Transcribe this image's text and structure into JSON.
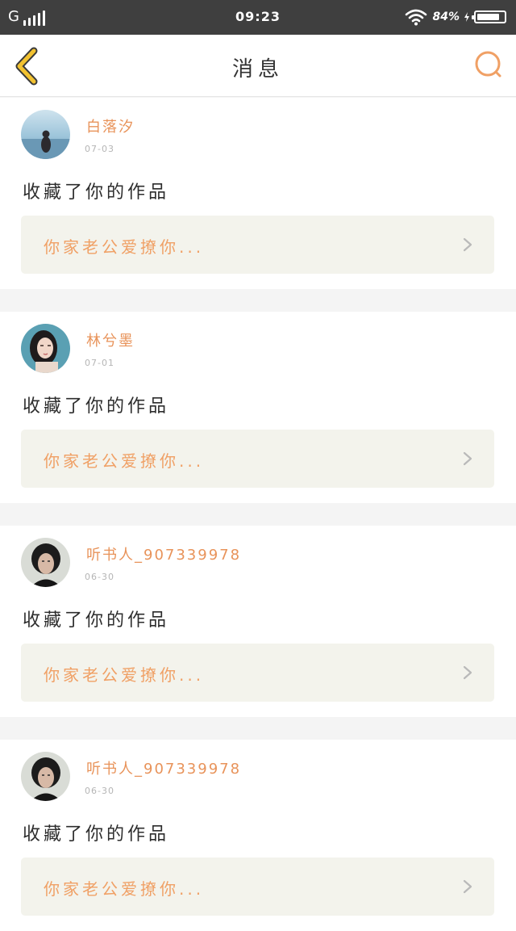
{
  "status_bar": {
    "carrier": "G",
    "time": "09:23",
    "battery_text": "84%",
    "battery_level": 0.84,
    "icons": [
      "signal-icon",
      "wifi-icon",
      "battery-icon",
      "charging-icon"
    ]
  },
  "header": {
    "title": "消息",
    "back_icon": "chevron-left-icon",
    "search_icon": "search-icon"
  },
  "colors": {
    "accent": "#e8935a",
    "work_title": "#f0a065",
    "work_bg": "#f3f3ec",
    "back_arrow": "#f2c230"
  },
  "messages": [
    {
      "username": "白落汐",
      "date": "07-03",
      "action": "收藏了你的作品",
      "work_title": "你家老公爱撩你...",
      "avatar": "avatar-photo-sea"
    },
    {
      "username": "林兮墨",
      "date": "07-01",
      "action": "收藏了你的作品",
      "work_title": "你家老公爱撩你...",
      "avatar": "avatar-photo-woman"
    },
    {
      "username": "听书人_907339978",
      "date": "06-30",
      "action": "收藏了你的作品",
      "work_title": "你家老公爱撩你...",
      "avatar": "avatar-photo-man"
    },
    {
      "username": "听书人_907339978",
      "date": "06-30",
      "action": "收藏了你的作品",
      "work_title": "你家老公爱撩你...",
      "avatar": "avatar-photo-man"
    }
  ]
}
